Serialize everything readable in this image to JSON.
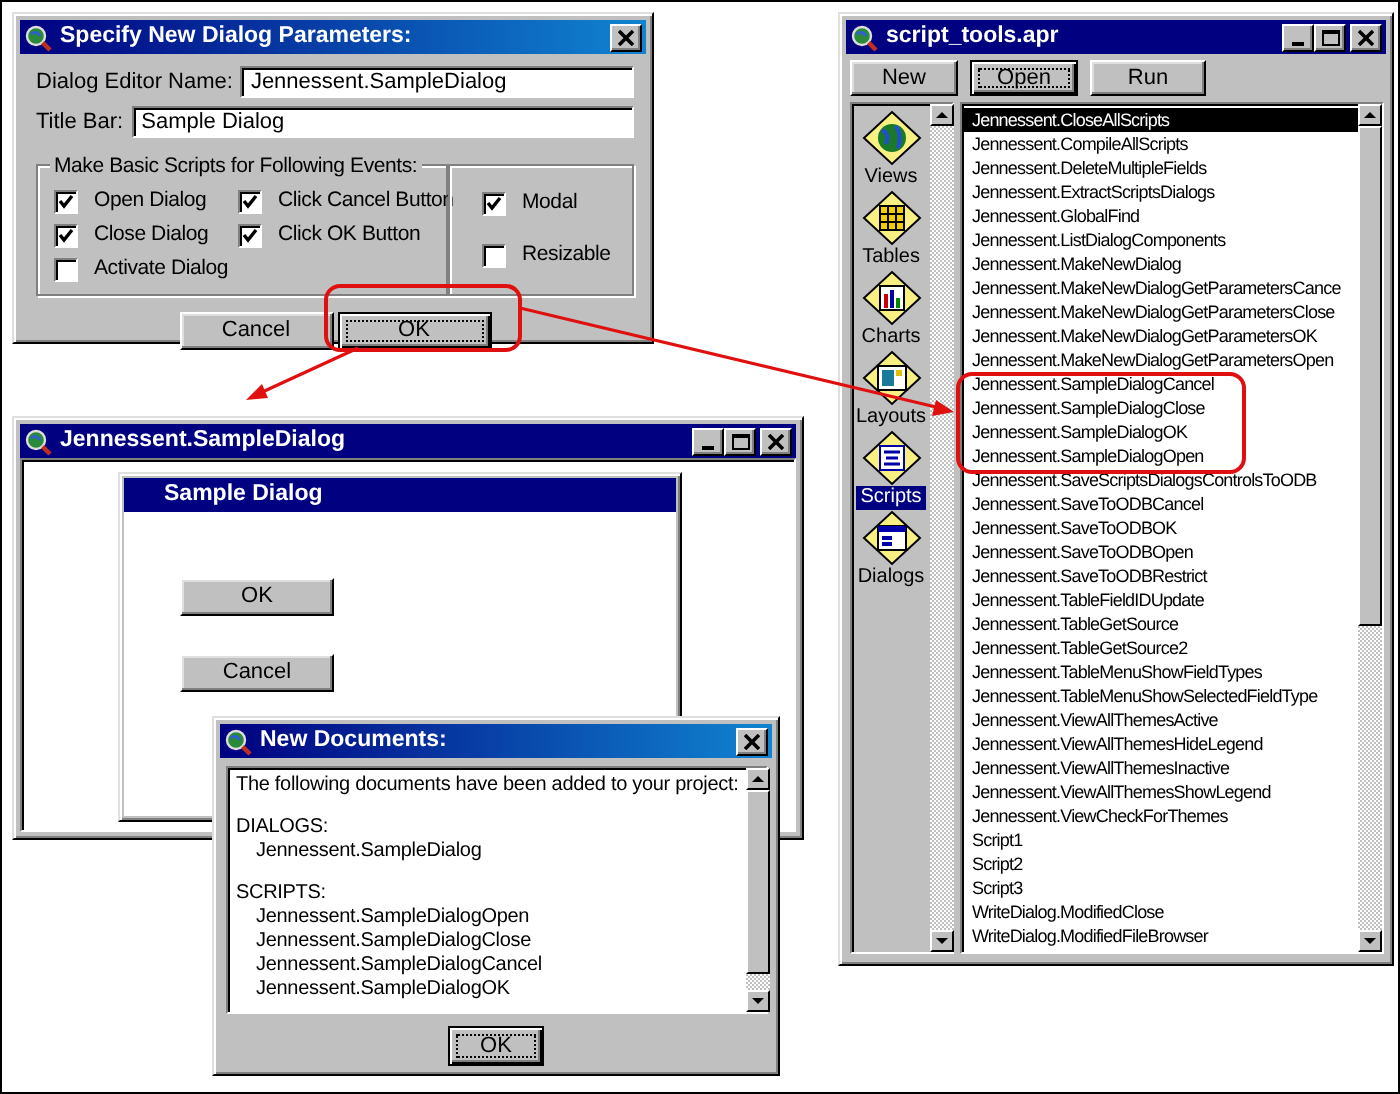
{
  "parameters_dialog": {
    "title": "Specify New Dialog Parameters:",
    "fields": [
      {
        "label": "Dialog Editor Name:",
        "value": "Jennessent.SampleDialog"
      },
      {
        "label": "Title Bar:",
        "value": "Sample Dialog"
      }
    ],
    "group_label": "Make Basic Scripts for Following Events:",
    "events": [
      {
        "label": "Open Dialog",
        "checked": true
      },
      {
        "label": "Close Dialog",
        "checked": true
      },
      {
        "label": "Activate Dialog",
        "checked": false
      },
      {
        "label": "Click Cancel Button",
        "checked": true
      },
      {
        "label": "Click OK Button",
        "checked": true
      }
    ],
    "options": [
      {
        "label": "Modal",
        "checked": true
      },
      {
        "label": "Resizable",
        "checked": false
      }
    ],
    "buttons": [
      {
        "label": "Cancel",
        "focused": false
      },
      {
        "label": "OK",
        "focused": true
      }
    ]
  },
  "project_window": {
    "title": "script_tools.apr",
    "buttons": [
      {
        "label": "New",
        "focused": false
      },
      {
        "label": "Open",
        "focused": true
      },
      {
        "label": "Run",
        "focused": false
      }
    ],
    "doc_types": [
      {
        "label": "Views",
        "kind": "globe",
        "selected": false
      },
      {
        "label": "Tables",
        "kind": "table",
        "selected": false
      },
      {
        "label": "Charts",
        "kind": "chart",
        "selected": false
      },
      {
        "label": "Layouts",
        "kind": "layout",
        "selected": false
      },
      {
        "label": "Scripts",
        "kind": "script",
        "selected": true
      },
      {
        "label": "Dialogs",
        "kind": "dialog",
        "selected": false
      }
    ],
    "scripts": [
      {
        "label": "Jennessent.CloseAllScripts",
        "selected": true
      },
      {
        "label": "Jennessent.CompileAllScripts",
        "selected": false
      },
      {
        "label": "Jennessent.DeleteMultipleFields",
        "selected": false
      },
      {
        "label": "Jennessent.ExtractScriptsDialogs",
        "selected": false
      },
      {
        "label": "Jennessent.GlobalFind",
        "selected": false
      },
      {
        "label": "Jennessent.ListDialogComponents",
        "selected": false
      },
      {
        "label": "Jennessent.MakeNewDialog",
        "selected": false
      },
      {
        "label": "Jennessent.MakeNewDialogGetParametersCance",
        "selected": false
      },
      {
        "label": "Jennessent.MakeNewDialogGetParametersClose",
        "selected": false
      },
      {
        "label": "Jennessent.MakeNewDialogGetParametersOK",
        "selected": false
      },
      {
        "label": "Jennessent.MakeNewDialogGetParametersOpen",
        "selected": false
      },
      {
        "label": "Jennessent.SampleDialogCancel",
        "selected": false
      },
      {
        "label": "Jennessent.SampleDialogClose",
        "selected": false
      },
      {
        "label": "Jennessent.SampleDialogOK",
        "selected": false
      },
      {
        "label": "Jennessent.SampleDialogOpen",
        "selected": false
      },
      {
        "label": "Jennessent.SaveScriptsDialogsControlsToODB",
        "selected": false
      },
      {
        "label": "Jennessent.SaveToODBCancel",
        "selected": false
      },
      {
        "label": "Jennessent.SaveToODBOK",
        "selected": false
      },
      {
        "label": "Jennessent.SaveToODBOpen",
        "selected": false
      },
      {
        "label": "Jennessent.SaveToODBRestrict",
        "selected": false
      },
      {
        "label": "Jennessent.TableFieldIDUpdate",
        "selected": false
      },
      {
        "label": "Jennessent.TableGetSource",
        "selected": false
      },
      {
        "label": "Jennessent.TableGetSource2",
        "selected": false
      },
      {
        "label": "Jennessent.TableMenuShowFieldTypes",
        "selected": false
      },
      {
        "label": "Jennessent.TableMenuShowSelectedFieldType",
        "selected": false
      },
      {
        "label": "Jennessent.ViewAllThemesActive",
        "selected": false
      },
      {
        "label": "Jennessent.ViewAllThemesHideLegend",
        "selected": false
      },
      {
        "label": "Jennessent.ViewAllThemesInactive",
        "selected": false
      },
      {
        "label": "Jennessent.ViewAllThemesShowLegend",
        "selected": false
      },
      {
        "label": "Jennessent.ViewCheckForThemes",
        "selected": false
      },
      {
        "label": "Script1",
        "selected": false
      },
      {
        "label": "Script2",
        "selected": false
      },
      {
        "label": "Script3",
        "selected": false
      },
      {
        "label": "WriteDialog.ModifiedClose",
        "selected": false
      },
      {
        "label": "WriteDialog.ModifiedFileBrowser",
        "selected": false
      }
    ]
  },
  "dialog_editor_window": {
    "title": "Jennessent.SampleDialog",
    "dialog": {
      "title": "Sample Dialog",
      "buttons": [
        "OK",
        "Cancel"
      ]
    }
  },
  "new_documents_dialog": {
    "title": "New Documents:",
    "intro": "The following documents have been added to your project:",
    "sections": [
      {
        "heading": "DIALOGS:",
        "items": [
          "Jennessent.SampleDialog"
        ]
      },
      {
        "heading": "SCRIPTS:",
        "items": [
          "Jennessent.SampleDialogOpen",
          "Jennessent.SampleDialogClose",
          "Jennessent.SampleDialogCancel",
          "Jennessent.SampleDialogOK"
        ]
      }
    ],
    "buttons": [
      {
        "label": "OK",
        "focused": true
      }
    ]
  }
}
